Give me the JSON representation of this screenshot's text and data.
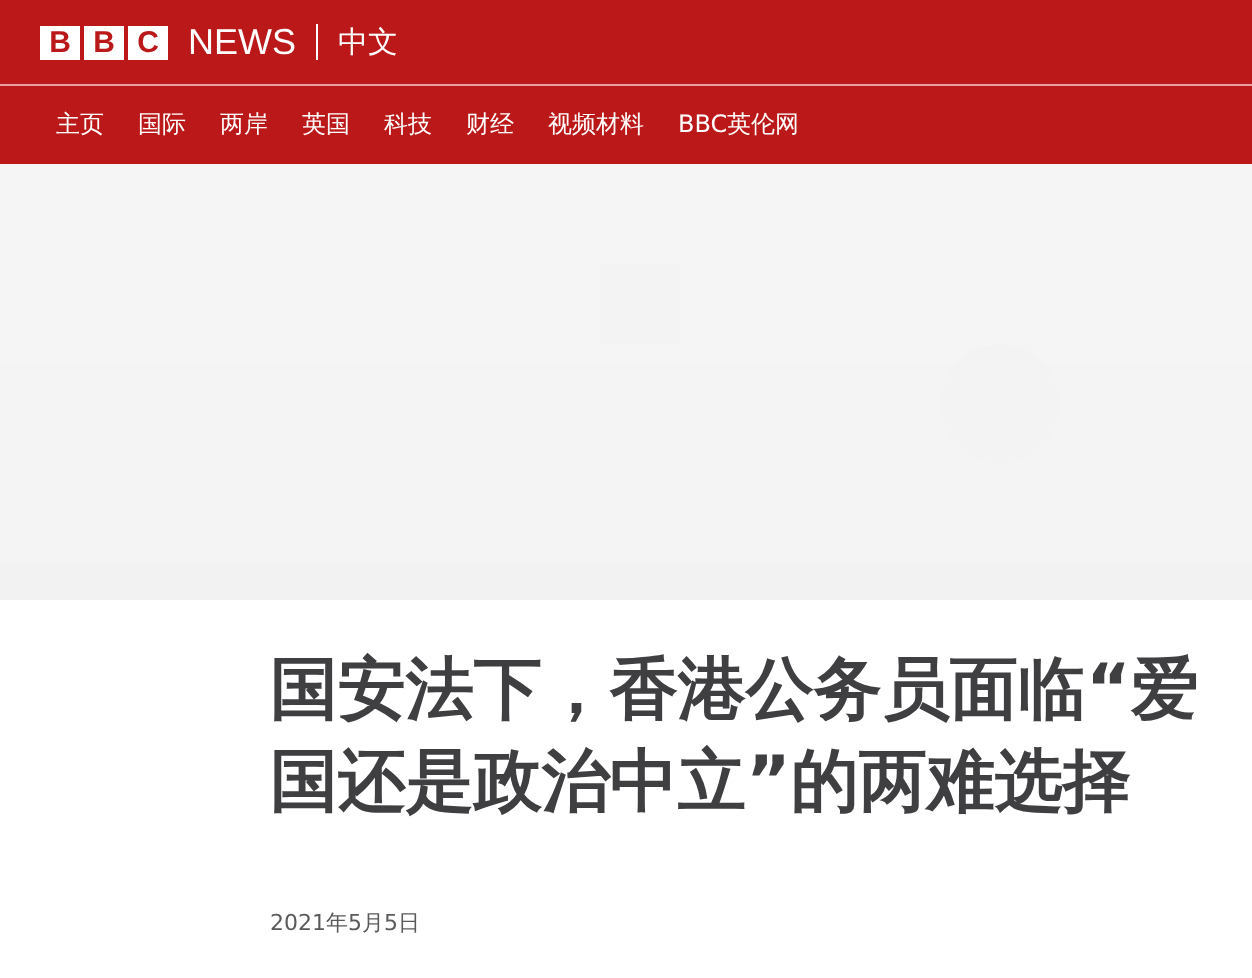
{
  "brand": {
    "blocks": [
      "B",
      "B",
      "C"
    ],
    "name": "NEWS",
    "edition": "中文"
  },
  "nav": {
    "items": [
      "主页",
      "国际",
      "两岸",
      "英国",
      "科技",
      "财经",
      "视频材料",
      "BBC英伦网"
    ]
  },
  "article": {
    "headline": "国安法下，香港公务员面临“爱国还是政治中立”的两难选择",
    "date": "2021年5月5日"
  }
}
